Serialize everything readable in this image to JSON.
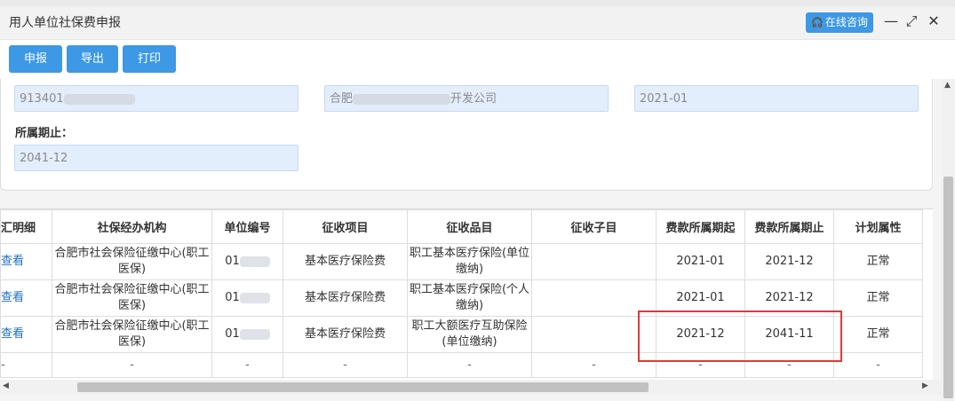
{
  "window": {
    "title": "用人单位社保费申报",
    "consult_label": "在线咨询",
    "minimize_glyph": "—",
    "maximize_glyph": "⤢",
    "close_glyph": "✕"
  },
  "toolbar": {
    "declare_label": "申报",
    "export_label": "导出",
    "print_label": "打印"
  },
  "form": {
    "credit_code_value": "913401",
    "company_name_prefix": "合肥",
    "company_name_suffix": "开发公司",
    "period_start_value": "2021-01",
    "period_end_label": "所属期止：",
    "period_end_value": "2041-12"
  },
  "table": {
    "headers": [
      "汇明细",
      "社保经办机构",
      "单位编号",
      "征收项目",
      "征收品目",
      "征收子目",
      "费款所属期起",
      "费款所属期止",
      "计划属性"
    ],
    "rows": [
      {
        "action": "查看",
        "agency": "合肥市社会保险征缴中心(职工医保)",
        "unit_no": "01",
        "item": "基本医疗保险费",
        "category": "职工基本医疗保险(单位缴纳)",
        "sub": "",
        "start": "2021-01",
        "end": "2021-12",
        "attr": "正常"
      },
      {
        "action": "查看",
        "agency": "合肥市社会保险征缴中心(职工医保)",
        "unit_no": "01",
        "item": "基本医疗保险费",
        "category": "职工基本医疗保险(个人缴纳)",
        "sub": "",
        "start": "2021-01",
        "end": "2021-12",
        "attr": "正常"
      },
      {
        "action": "查看",
        "agency": "合肥市社会保险征缴中心(职工医保)",
        "unit_no": "01",
        "item": "基本医疗保险费",
        "category": "职工大额医疗互助保险(单位缴纳)",
        "sub": "",
        "start": "2021-12",
        "end": "2041-11",
        "attr": "正常"
      }
    ],
    "empty_row_mark": "-"
  },
  "colors": {
    "accent": "#3d98e6",
    "field_bg": "#e3eefc",
    "highlight": "#e0393b",
    "link": "#1f6fc1"
  }
}
